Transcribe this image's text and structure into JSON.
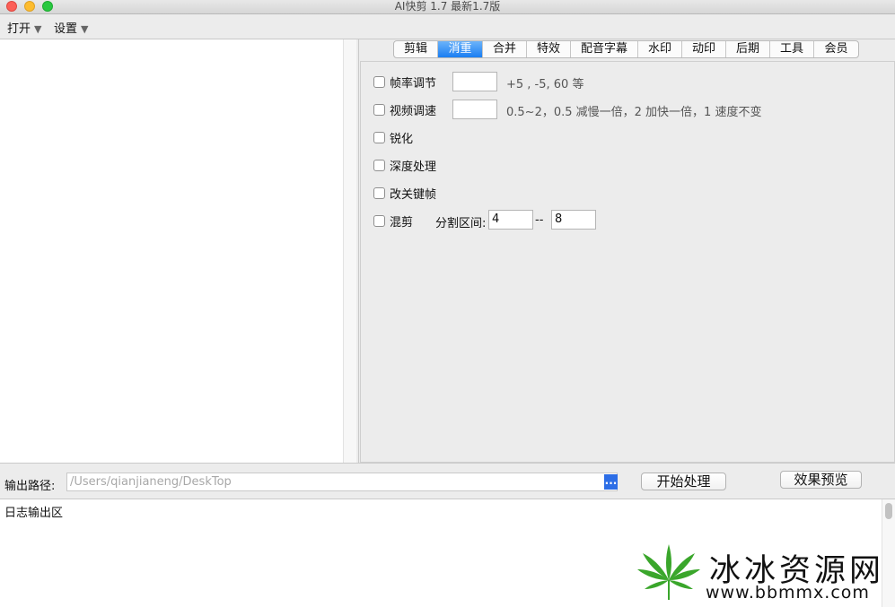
{
  "window": {
    "title": "AI快剪  1.7    最新1.7版"
  },
  "menubar": {
    "items": [
      "打开",
      "设置"
    ],
    "caret": "▼"
  },
  "tabs": [
    {
      "label": "剪辑",
      "active": false
    },
    {
      "label": "消重",
      "active": true
    },
    {
      "label": "合并",
      "active": false
    },
    {
      "label": "特效",
      "active": false
    },
    {
      "label": "配音字幕",
      "active": false
    },
    {
      "label": "水印",
      "active": false
    },
    {
      "label": "动印",
      "active": false
    },
    {
      "label": "后期",
      "active": false
    },
    {
      "label": "工具",
      "active": false
    },
    {
      "label": "会员",
      "active": false
    }
  ],
  "options": {
    "frame_rate": {
      "label": "帧率调节",
      "value": "",
      "hint": "+5 , -5, 60 等",
      "checked": false
    },
    "video_speed": {
      "label": "视频调速",
      "value": "",
      "hint": "0.5~2，0.5 减慢一倍，2 加快一倍，1 速度不变",
      "checked": false
    },
    "sharpen": {
      "label": "锐化",
      "checked": false
    },
    "depth": {
      "label": "深度处理",
      "checked": false
    },
    "keyframe": {
      "label": "改关键帧",
      "checked": false
    },
    "mix_cut": {
      "label": "混剪",
      "checked": false,
      "range_label": "分割区间:",
      "range_from": "4",
      "range_sep": "--",
      "range_to": "8"
    }
  },
  "output": {
    "label": "输出路径:",
    "path_placeholder": "/Users/qianjianeng/DeskTop",
    "browse_label": "...",
    "start_button": "开始处理",
    "preview_button": "效果预览"
  },
  "log": {
    "title": "日志输出区"
  },
  "watermark": {
    "name": "冰冰资源网",
    "url": "www.bbmmx.com"
  },
  "colors": {
    "accent": "#1a7ef2",
    "browse": "#2d6ee6"
  }
}
